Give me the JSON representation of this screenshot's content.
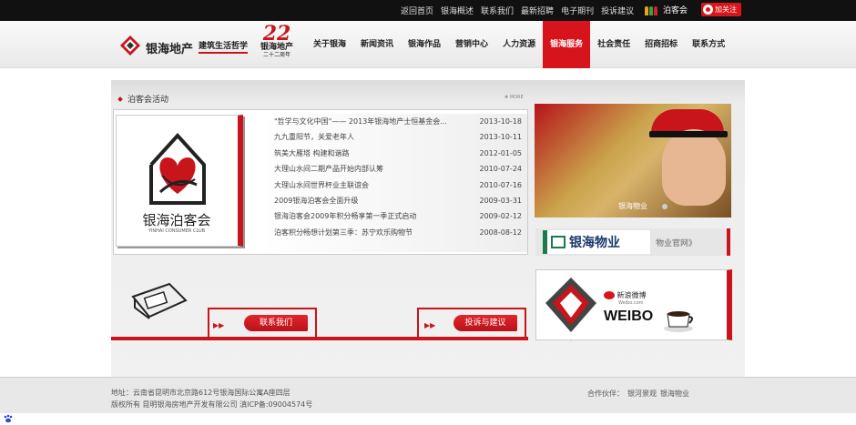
{
  "topbar": {
    "links": [
      "返回首页",
      "银海概述",
      "联系我们",
      "最新招聘",
      "电子期刊",
      "投诉建议"
    ],
    "club_label": "泊客会",
    "weibo_follow_label": "加关注"
  },
  "header": {
    "logo_text": "银海地产",
    "slogan": "建筑生活哲学",
    "anniversary_number": "22",
    "anniversary_line1": "银海地产",
    "anniversary_line2": "二十二周年",
    "nav": [
      "关于银海",
      "新闻资讯",
      "银海作品",
      "营销中心",
      "人力资源",
      "银海服务",
      "社会责任",
      "招商招标",
      "联系方式"
    ],
    "active_nav": "银海服务"
  },
  "section": {
    "title": "泊客会活动",
    "more_label": "MORE",
    "club_name": "银海泊客会",
    "club_en": "YINHAI CONSUMER CLUB",
    "news": [
      {
        "title": "\"哲学与文化中国\"—— 2013年银海地产士恒基金会...",
        "date": "2013-10-18"
      },
      {
        "title": "九九重阳节，关爱老年人",
        "date": "2013-10-11"
      },
      {
        "title": "筑美大雁塔 构建和谐路",
        "date": "2012-01-05"
      },
      {
        "title": "大理山水间二期产品开始内部认筹",
        "date": "2010-07-24"
      },
      {
        "title": "大理山水间世界杯业主联谊会",
        "date": "2010-07-16"
      },
      {
        "title": "2009银海泊客会全面升级",
        "date": "2009-03-31"
      },
      {
        "title": "银海泊客会2009年积分畅享第一季正式启动",
        "date": "2009-02-12"
      },
      {
        "title": "泊客积分畅想计划第三季：苏宁欢乐购物节",
        "date": "2008-08-12"
      }
    ]
  },
  "property": {
    "photo_caption": "银海物业",
    "banner_name": "银海物业",
    "banner_link": "物业官网》"
  },
  "tiles": {
    "contact_label": "联系我们",
    "complaint_label": "投诉与建议",
    "weibo_cn": "新浪微博",
    "weibo_url": "Weibo.com",
    "weibo_word": "WEIBO"
  },
  "footer": {
    "address": "地址：云南省昆明市北京路612号银海国际公寓A座四层",
    "copyright": "版权所有 昆明银海房地产开发有限公司 滇ICP备:09004574号",
    "partners_label": "合作伙伴：",
    "partners": [
      "银河景观",
      "银海物业"
    ]
  },
  "colors": {
    "accent": "#c8141b",
    "topbar": "#111111"
  }
}
